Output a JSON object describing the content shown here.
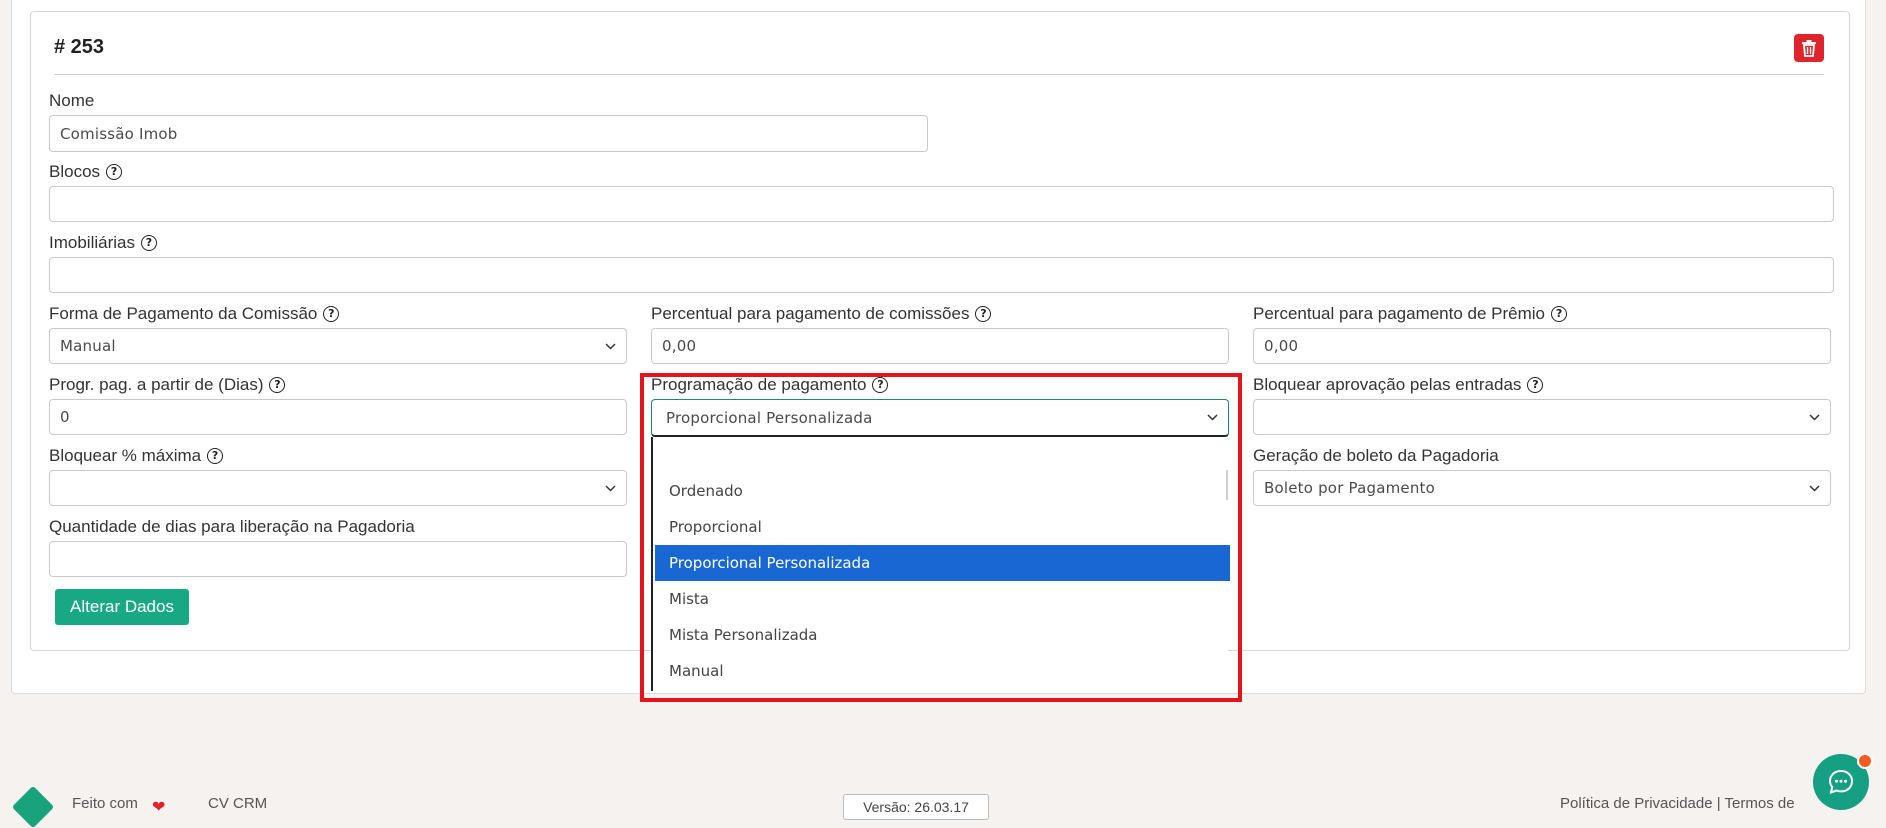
{
  "card": {
    "title": "# 253"
  },
  "form": {
    "nome": {
      "label": "Nome",
      "value": "Comissão Imob"
    },
    "blocos": {
      "label": "Blocos",
      "value": ""
    },
    "imobiliarias": {
      "label": "Imobiliárias",
      "value": ""
    },
    "forma_pagamento": {
      "label": "Forma de Pagamento da Comissão",
      "value": "Manual"
    },
    "percentual_comissoes": {
      "label": "Percentual para pagamento de comissões",
      "value": "0,00"
    },
    "percentual_premio": {
      "label": "Percentual para pagamento de Prêmio",
      "value": "0,00"
    },
    "progr_pag": {
      "label": "Progr. pag. a partir de (Dias)",
      "value": "0"
    },
    "programacao_pagamento": {
      "label": "Programação de pagamento",
      "value": "Proporcional Personalizada",
      "options": [
        "",
        "Ordenado",
        "Proporcional",
        "Proporcional Personalizada",
        "Mista",
        "Mista Personalizada",
        "Manual"
      ],
      "selected_index": 3
    },
    "bloquear_aprovacao": {
      "label": "Bloquear aprovação pelas entradas",
      "value": ""
    },
    "bloquear_maxima": {
      "label": "Bloquear % máxima",
      "value": ""
    },
    "geracao_boleto": {
      "label": "Geração de boleto da Pagadoria",
      "value": "Boleto por Pagamento"
    },
    "qtd_dias": {
      "label": "Quantidade de dias para liberação na Pagadoria",
      "value": ""
    }
  },
  "buttons": {
    "alterar": "Alterar Dados"
  },
  "footer": {
    "made_with": "Feito com",
    "brand": "CV CRM",
    "version": "Versão: 26.03.17",
    "links": "Política de Privacidade | Termos de"
  },
  "icons": {
    "delete": "trash-icon",
    "help": "question-circle-icon",
    "chat": "chat-icon",
    "heart": "heart-icon",
    "caret": "chevron-down-icon"
  },
  "colors": {
    "primary": "#19a884",
    "danger": "#e0242b",
    "selected_option": "#1967d2",
    "highlight": "#e5131b"
  }
}
